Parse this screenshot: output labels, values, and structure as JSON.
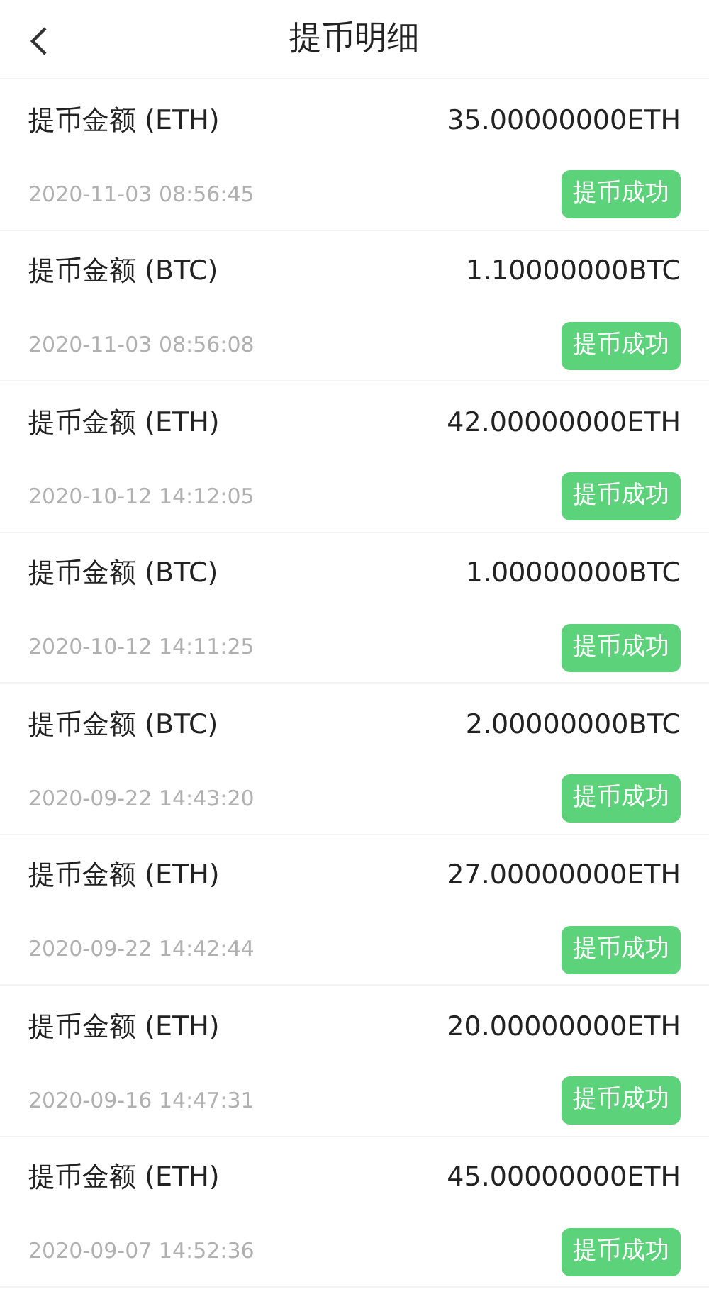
{
  "header": {
    "title": "提币明细"
  },
  "records": [
    {
      "label": "提币金额 (ETH)",
      "amount": "35.00000000ETH",
      "time": "2020-11-03 08:56:45",
      "status": "提币成功"
    },
    {
      "label": "提币金额 (BTC)",
      "amount": "1.10000000BTC",
      "time": "2020-11-03 08:56:08",
      "status": "提币成功"
    },
    {
      "label": "提币金额 (ETH)",
      "amount": "42.00000000ETH",
      "time": "2020-10-12 14:12:05",
      "status": "提币成功"
    },
    {
      "label": "提币金额 (BTC)",
      "amount": "1.00000000BTC",
      "time": "2020-10-12 14:11:25",
      "status": "提币成功"
    },
    {
      "label": "提币金额 (BTC)",
      "amount": "2.00000000BTC",
      "time": "2020-09-22 14:43:20",
      "status": "提币成功"
    },
    {
      "label": "提币金额 (ETH)",
      "amount": "27.00000000ETH",
      "time": "2020-09-22 14:42:44",
      "status": "提币成功"
    },
    {
      "label": "提币金额 (ETH)",
      "amount": "20.00000000ETH",
      "time": "2020-09-16 14:47:31",
      "status": "提币成功"
    },
    {
      "label": "提币金额 (ETH)",
      "amount": "45.00000000ETH",
      "time": "2020-09-07 14:52:36",
      "status": "提币成功"
    }
  ]
}
